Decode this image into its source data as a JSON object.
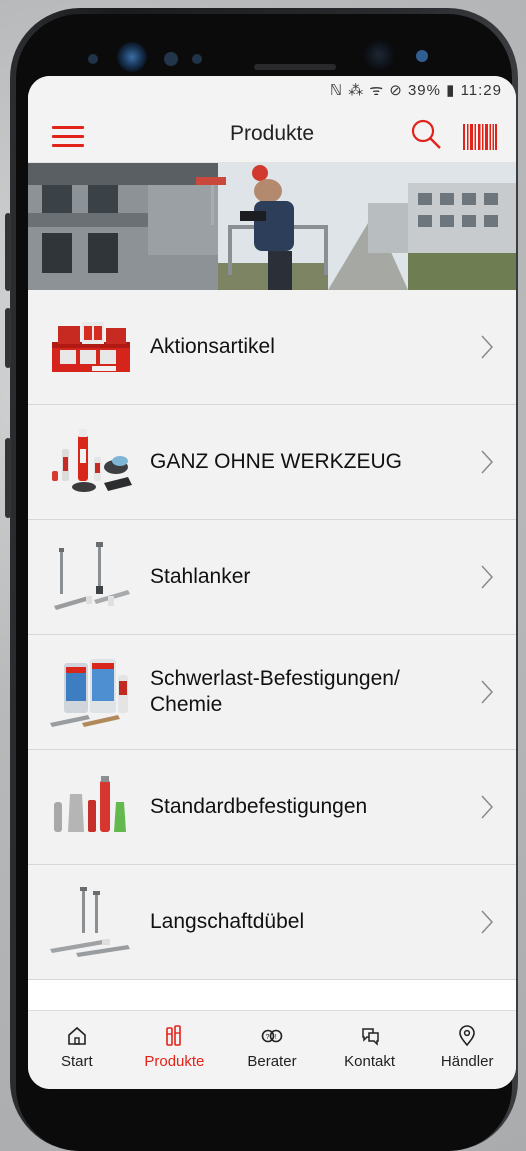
{
  "status_bar": {
    "text": "ℕ ⁂ ᯤ ⊘ 39% ▮ 11:29",
    "battery": "39%",
    "time": "11:29"
  },
  "header": {
    "title": "Produkte",
    "menu_icon": "hamburger-menu-icon",
    "search_icon": "search-icon",
    "barcode_icon": "barcode-scanner-icon"
  },
  "colors": {
    "accent": "#e2231a",
    "list_bg": "#f2f2f2",
    "bar_bg": "#f3f3f3"
  },
  "categories": [
    {
      "label": "Aktionsartikel",
      "icon": "promo-boxes-thumb"
    },
    {
      "label": "GANZ OHNE WERKZEUG",
      "icon": "tool-free-products-thumb"
    },
    {
      "label": "Stahlanker",
      "icon": "steel-anchor-thumb"
    },
    {
      "label": "Schwerlast-Befestigungen/ Chemie",
      "icon": "chemical-anchor-thumb"
    },
    {
      "label": "Standardbefestigungen",
      "icon": "standard-plugs-thumb"
    },
    {
      "label": "Langschaftdübel",
      "icon": "long-shaft-plug-thumb"
    }
  ],
  "tabs": [
    {
      "label": "Start",
      "icon": "home-icon",
      "active": false
    },
    {
      "label": "Produkte",
      "icon": "products-icon",
      "active": true
    },
    {
      "label": "Berater",
      "icon": "advisor-icon",
      "active": false
    },
    {
      "label": "Kontakt",
      "icon": "chat-icon",
      "active": false
    },
    {
      "label": "Händler",
      "icon": "location-pin-icon",
      "active": false
    }
  ]
}
